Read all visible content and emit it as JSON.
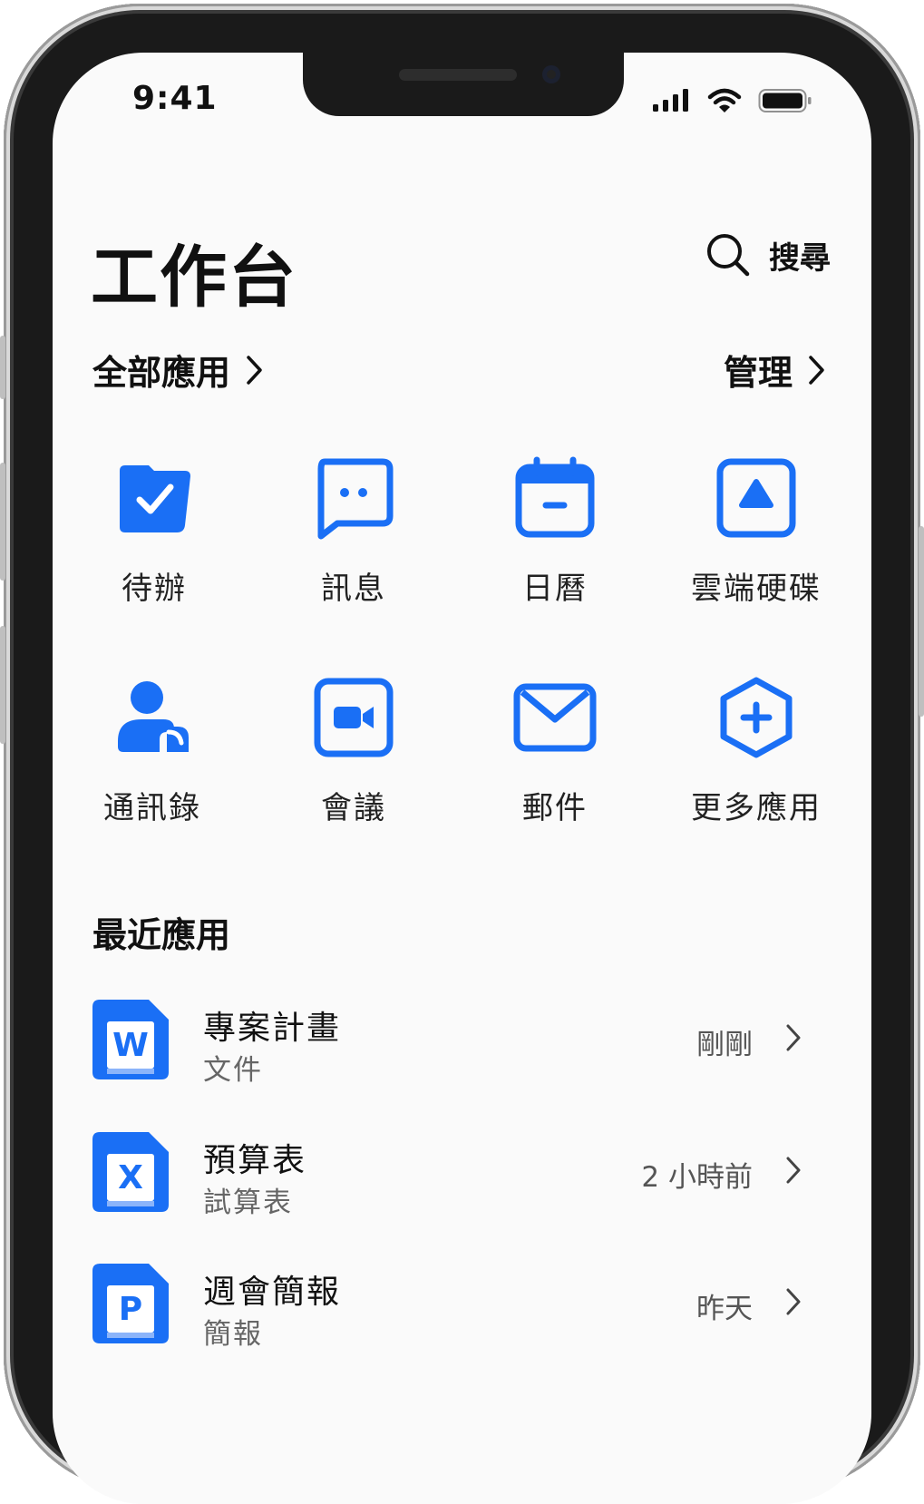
{
  "status_bar": {
    "time": "9:41"
  },
  "header": {
    "title": "工作台",
    "search_label": "搜尋"
  },
  "apps_section": {
    "all_apps_label": "全部應用",
    "manage_label": "管理",
    "apps": [
      {
        "label": "待辦",
        "icon": "todo-check-icon"
      },
      {
        "label": "訊息",
        "icon": "message-bubble-icon"
      },
      {
        "label": "日曆",
        "icon": "calendar-icon"
      },
      {
        "label": "雲端硬碟",
        "icon": "cloud-drive-icon"
      },
      {
        "label": "通訊錄",
        "icon": "contacts-icon"
      },
      {
        "label": "會議",
        "icon": "video-meeting-icon"
      },
      {
        "label": "郵件",
        "icon": "mail-icon"
      },
      {
        "label": "更多應用",
        "icon": "more-apps-plus-icon"
      }
    ]
  },
  "recent_section": {
    "title": "最近應用",
    "items": [
      {
        "name": "專案計畫",
        "type": "文件",
        "time": "剛剛",
        "letter": "W",
        "icon": "word-document-icon"
      },
      {
        "name": "預算表",
        "type": "試算表",
        "time": "2 小時前",
        "letter": "X",
        "icon": "spreadsheet-icon"
      },
      {
        "name": "週會簡報",
        "type": "簡報",
        "time": "昨天",
        "letter": "P",
        "icon": "presentation-icon"
      }
    ]
  },
  "colors": {
    "accent": "#1a6ff5",
    "text": "#111111",
    "muted": "#666666"
  }
}
